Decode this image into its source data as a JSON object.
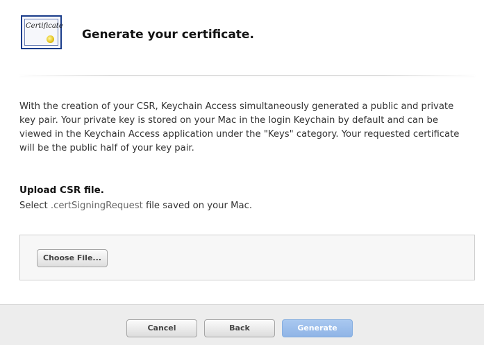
{
  "header": {
    "icon": "certificate-icon",
    "icon_text": "Certificate",
    "title": "Generate your certificate."
  },
  "description": "With the creation of your CSR, Keychain Access simultaneously generated a public and private key pair. Your private key is stored on your Mac in the login Keychain by default and can be viewed in the Keychain Access application under the \"Keys\" category. Your requested certificate will be the public half of your key pair.",
  "upload": {
    "title": "Upload CSR file.",
    "sub_prefix": "Select ",
    "sub_code": ".certSigningRequest",
    "sub_suffix": " file saved on your Mac.",
    "choose_label": "Choose File..."
  },
  "footer": {
    "cancel_label": "Cancel",
    "back_label": "Back",
    "generate_label": "Generate"
  },
  "colors": {
    "primary_button": "#8fb4e6",
    "footer_bg": "#ededed"
  }
}
